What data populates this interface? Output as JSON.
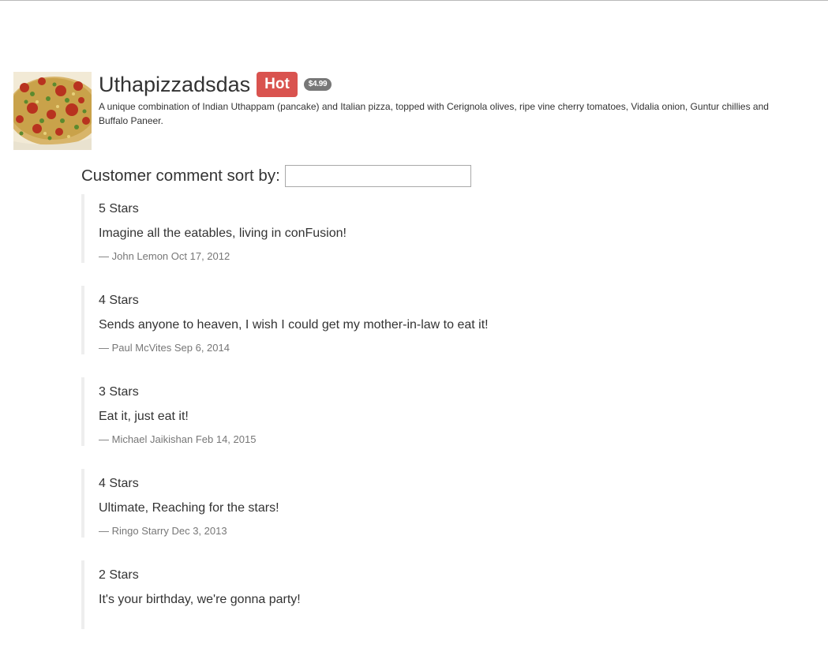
{
  "dish": {
    "name": "Uthapizzadsdas",
    "label": "Hot",
    "price": "$4.99",
    "description": "A unique combination of Indian Uthappam (pancake) and Italian pizza, topped with Cerignola olives, ripe vine cherry tomatoes, Vidalia onion, Guntur chillies and Buffalo Paneer.",
    "image_icon": "pizza-image"
  },
  "sort": {
    "label": "Customer comment sort by:",
    "value": "",
    "placeholder": ""
  },
  "comments": [
    {
      "rating": "5 Stars",
      "text": "Imagine all the eatables, living in conFusion!",
      "author": "John Lemon",
      "date": "Oct 17, 2012",
      "byline": "— John Lemon Oct 17, 2012"
    },
    {
      "rating": "4 Stars",
      "text": "Sends anyone to heaven, I wish I could get my mother-in-law to eat it!",
      "author": "Paul McVites",
      "date": "Sep 6, 2014",
      "byline": "— Paul McVites Sep 6, 2014"
    },
    {
      "rating": "3 Stars",
      "text": "Eat it, just eat it!",
      "author": "Michael Jaikishan",
      "date": "Feb 14, 2015",
      "byline": "— Michael Jaikishan Feb 14, 2015"
    },
    {
      "rating": "4 Stars",
      "text": "Ultimate, Reaching for the stars!",
      "author": "Ringo Starry",
      "date": "Dec 3, 2013",
      "byline": "— Ringo Starry Dec 3, 2013"
    },
    {
      "rating": "2 Stars",
      "text": "It's your birthday, we're gonna party!",
      "author": "",
      "date": "",
      "byline": ""
    }
  ],
  "colors": {
    "hot_label": "#d9534f",
    "price_badge": "#777777",
    "text": "#333333",
    "muted": "#777777",
    "quote_border": "#eeeeee"
  }
}
